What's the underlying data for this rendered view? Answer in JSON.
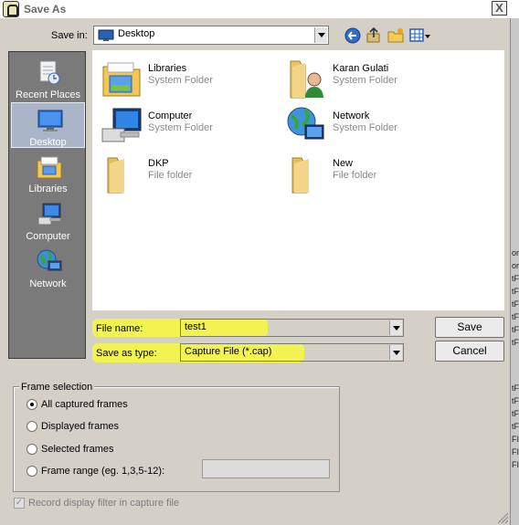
{
  "window": {
    "title": "Save As",
    "close_label": "X"
  },
  "toolbar": {
    "save_in_label": "Save in:",
    "location": "Desktop",
    "icons": [
      "back-arrow-icon",
      "up-folder-icon",
      "new-folder-icon",
      "view-menu-icon"
    ]
  },
  "places": [
    {
      "label": "Recent Places",
      "icon": "recent-places-icon",
      "selected": false
    },
    {
      "label": "Desktop",
      "icon": "desktop-icon",
      "selected": true
    },
    {
      "label": "Libraries",
      "icon": "libraries-icon",
      "selected": false
    },
    {
      "label": "Computer",
      "icon": "computer-icon",
      "selected": false
    },
    {
      "label": "Network",
      "icon": "network-icon",
      "selected": false
    }
  ],
  "files": [
    {
      "name": "Libraries",
      "type": "System Folder",
      "icon": "libraries-folder-icon"
    },
    {
      "name": "Karan Gulati",
      "type": "System Folder",
      "icon": "user-folder-icon"
    },
    {
      "name": "Computer",
      "type": "System Folder",
      "icon": "computer-icon"
    },
    {
      "name": "Network",
      "type": "System Folder",
      "icon": "network-globe-icon"
    },
    {
      "name": "DKP",
      "type": "File folder",
      "icon": "folder-icon"
    },
    {
      "name": "New",
      "type": "File folder",
      "icon": "folder-icon"
    }
  ],
  "form": {
    "file_name_label": "File name:",
    "file_name_value": "test1",
    "type_label": "Save as type:",
    "type_value": "Capture File (*.cap)",
    "save_label": "Save",
    "cancel_label": "Cancel"
  },
  "frame_selection": {
    "title": "Frame selection",
    "options": [
      "All captured frames",
      "Displayed frames",
      "Selected frames",
      "Frame range (eg. 1,3,5-12):"
    ],
    "selected_index": 0,
    "range_value": ""
  },
  "record_filter": {
    "label": "Record display filter in capture file",
    "checked": true,
    "disabled": true
  },
  "background_fragments": [
    "or",
    "or",
    "tF",
    "tF",
    "tF",
    "tF",
    "tF",
    "tF",
    "tF",
    "tF",
    "tF",
    "tF",
    "FI",
    "FI",
    "FI"
  ],
  "colors": {
    "highlight": "#f5f542",
    "places_bg": "#7a7a7a",
    "selection": "#aab6c8"
  }
}
